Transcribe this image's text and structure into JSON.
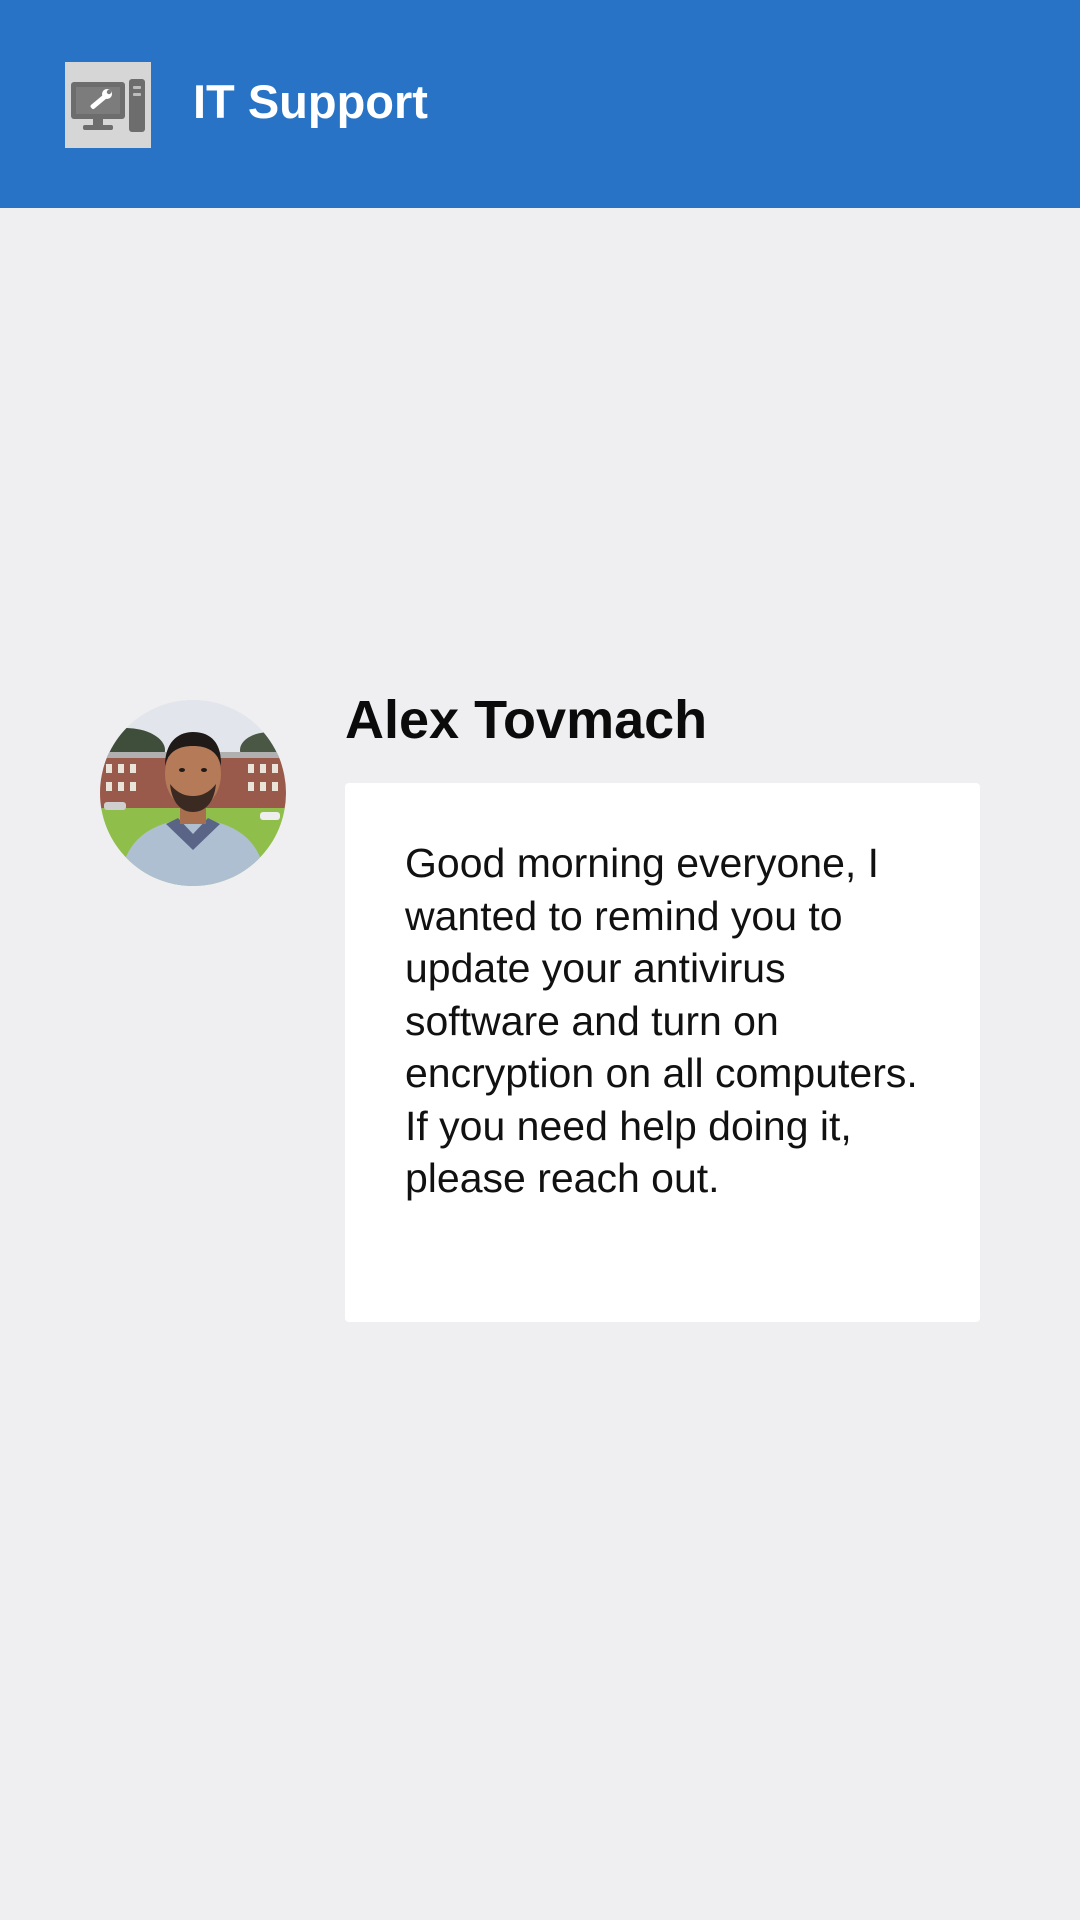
{
  "header": {
    "app_title": "IT Support",
    "app_icon": "computer-repair-icon",
    "background_color": "#2873c6"
  },
  "message": {
    "sender_name": "Alex Tovmach",
    "avatar": "user-avatar-photo",
    "text": "Good morning everyone, I wanted to remind you to update your antivirus software and turn on encryption on all computers. If you need help doing it, please reach out."
  },
  "colors": {
    "page_background": "#efeff1",
    "card_background": "#ffffff"
  }
}
